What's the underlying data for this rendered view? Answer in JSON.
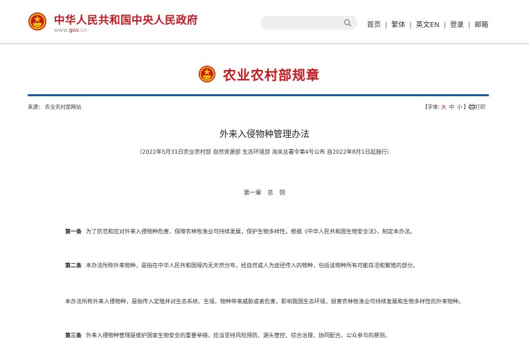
{
  "header": {
    "site_title": "中华人民共和国中央人民政府",
    "site_url_prefix": "www.",
    "site_url_gov": "gov",
    "site_url_suffix": ".cn",
    "search_placeholder": "",
    "nav": [
      "首页",
      "繁体",
      "英文EN",
      "登录",
      "邮箱"
    ],
    "nav_separator": "|"
  },
  "banner": {
    "title": "农业农村部规章"
  },
  "meta": {
    "source": "来源：  农业农村部网站",
    "font_label_open": "【字体:",
    "font_sizes": [
      "大",
      "中",
      "小"
    ],
    "font_label_close": "】",
    "print_label": "打印"
  },
  "article": {
    "title": "外来入侵物种管理办法",
    "subtitle": "（2022年5月31日农业农村部 自然资源部 生态环境部 海关总署令第4号公布  自2022年8月1日起施行）",
    "chapter": "第一章 总 则",
    "paragraphs": [
      {
        "lead": "第一条",
        "text": "为了防范和应对外来入侵物种危害，保障农林牧渔业可持续发展，保护生物多样性，根据《中华人民共和国生物安全法》，制定本办法。"
      },
      {
        "lead": "第二条",
        "text": "本办法所称外来物种，是指在中华人民共和国境内无天然分布，经自然或人为途径传入的物种，包括该物种所有可能存活和繁殖的部分。"
      },
      {
        "lead": "",
        "text": "本办法所称外来入侵物种，是指传入定殖并对生态系统、生境、物种带来威胁或者危害，影响我国生态环境，损害农林牧渔业可持续发展和生物多样性的外来物种。"
      },
      {
        "lead": "第三条",
        "text": "外来入侵物种管理是维护国家生物安全的重要举措，应当坚持风险预防、源头管控、综合治理、协同配合、公众参与的原则。"
      }
    ]
  },
  "colors": {
    "brand_red": "#c8161d",
    "rule_blue": "#1c5ea8",
    "rule_gray": "#d8dde6"
  },
  "icons": [
    "national-emblem-icon",
    "search-icon",
    "print-icon"
  ]
}
